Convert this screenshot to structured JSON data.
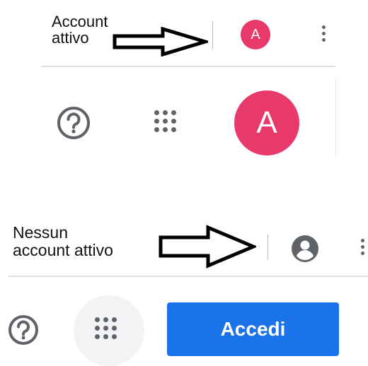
{
  "panel_active": {
    "annotation": [
      "Account",
      "attivo"
    ],
    "avatar_small_letter": "A",
    "avatar_large_letter": "A",
    "help_icon": "question-circle-icon",
    "apps_icon": "apps-grid-icon",
    "menu_icon": "more-vert-icon",
    "avatar_color": "#e8396b"
  },
  "panel_inactive": {
    "annotation": [
      "Nessun",
      "account attivo"
    ],
    "account_icon": "account-circle-icon",
    "menu_icon": "more-vert-icon",
    "help_icon": "question-circle-icon",
    "apps_icon": "apps-grid-icon",
    "signin_label": "Accedi",
    "signin_color": "#1a73e8"
  }
}
